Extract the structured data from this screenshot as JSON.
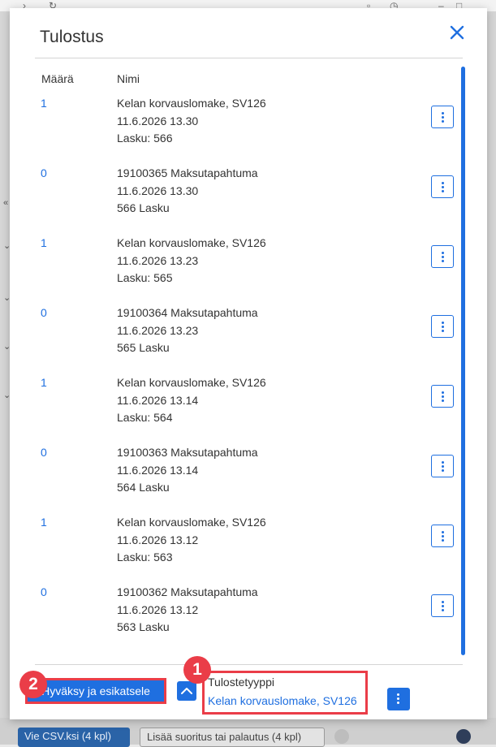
{
  "dialog": {
    "title": "Tulostus",
    "columns": {
      "quantity": "Määrä",
      "name": "Nimi"
    },
    "rows": [
      {
        "quantity": "1",
        "lines": [
          "Kelan korvauslomake, SV126",
          "11.6.2026 13.30",
          "Lasku: 566"
        ]
      },
      {
        "quantity": "0",
        "lines": [
          "19100365 Maksutapahtuma",
          "11.6.2026 13.30",
          "566 Lasku"
        ]
      },
      {
        "quantity": "1",
        "lines": [
          "Kelan korvauslomake, SV126",
          "11.6.2026 13.23",
          "Lasku: 565"
        ]
      },
      {
        "quantity": "0",
        "lines": [
          "19100364 Maksutapahtuma",
          "11.6.2026 13.23",
          "565 Lasku"
        ]
      },
      {
        "quantity": "1",
        "lines": [
          "Kelan korvauslomake, SV126",
          "11.6.2026 13.14",
          "Lasku: 564"
        ]
      },
      {
        "quantity": "0",
        "lines": [
          "19100363 Maksutapahtuma",
          "11.6.2026 13.14",
          "564 Lasku"
        ]
      },
      {
        "quantity": "1",
        "lines": [
          "Kelan korvauslomake, SV126",
          "11.6.2026 13.12",
          "Lasku: 563"
        ]
      },
      {
        "quantity": "0",
        "lines": [
          "19100362 Maksutapahtuma",
          "11.6.2026 13.12",
          "563 Lasku"
        ]
      }
    ]
  },
  "footer": {
    "approve_label": "Hyväksy ja esikatsele",
    "print_type_label": "Tulostetyyppi",
    "print_type_value": "Kelan korvauslomake, SV126"
  },
  "markers": {
    "first": "1",
    "second": "2"
  },
  "background": {
    "export_button": "Vie CSV.ksi (4 kpl)",
    "add_button": "Lisää suoritus tai palautus (4 kpl)"
  },
  "colors": {
    "accent": "#1f6fe0",
    "highlight": "#ea3d48"
  }
}
